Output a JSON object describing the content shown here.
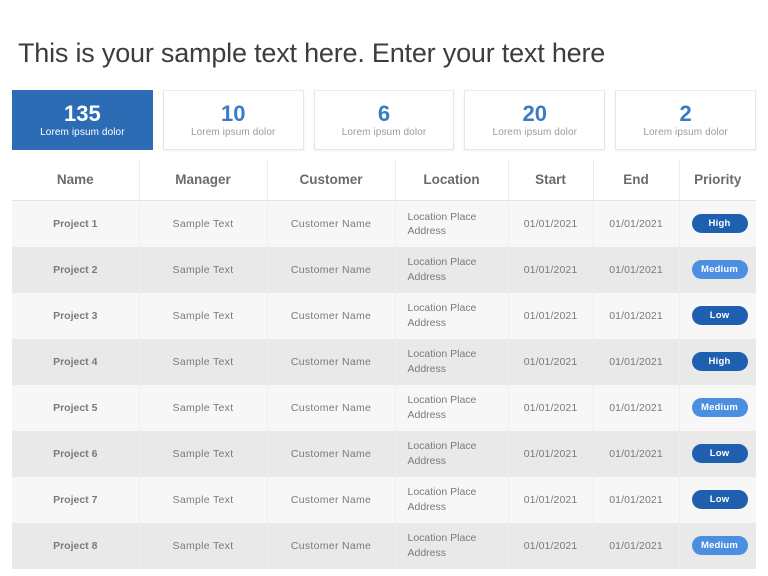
{
  "page_title": "This is your sample text here. Enter your text here",
  "colors": {
    "accent_dark": "#2b6cb5",
    "accent_number": "#3a7bc8",
    "badge_high": "#1f5fb0",
    "badge_low": "#1f5fb0",
    "badge_medium": "#4a8fe0",
    "row_odd": "#f7f7f7",
    "row_even": "#e9e9e9",
    "title_text": "#3d3d3d"
  },
  "kpis": [
    {
      "value": "135",
      "label": "Lorem ipsum dolor",
      "highlighted": true
    },
    {
      "value": "10",
      "label": "Lorem ipsum dolor",
      "highlighted": false
    },
    {
      "value": "6",
      "label": "Lorem ipsum dolor",
      "highlighted": false
    },
    {
      "value": "20",
      "label": "Lorem ipsum dolor",
      "highlighted": false
    },
    {
      "value": "2",
      "label": "Lorem ipsum dolor",
      "highlighted": false
    }
  ],
  "table": {
    "headers": [
      "Name",
      "Manager",
      "Customer",
      "Location",
      "Start",
      "End",
      "Priority"
    ],
    "rows": [
      {
        "name": "Project 1",
        "manager": "Sample Text",
        "customer": "Customer Name",
        "location": "Location Place Address",
        "start": "01/01/2021",
        "end": "01/01/2021",
        "priority": "High"
      },
      {
        "name": "Project 2",
        "manager": "Sample Text",
        "customer": "Customer Name",
        "location": "Location Place Address",
        "start": "01/01/2021",
        "end": "01/01/2021",
        "priority": "Medium"
      },
      {
        "name": "Project 3",
        "manager": "Sample Text",
        "customer": "Customer Name",
        "location": "Location Place Address",
        "start": "01/01/2021",
        "end": "01/01/2021",
        "priority": "Low"
      },
      {
        "name": "Project 4",
        "manager": "Sample Text",
        "customer": "Customer Name",
        "location": "Location Place Address",
        "start": "01/01/2021",
        "end": "01/01/2021",
        "priority": "High"
      },
      {
        "name": "Project 5",
        "manager": "Sample Text",
        "customer": "Customer Name",
        "location": "Location Place Address",
        "start": "01/01/2021",
        "end": "01/01/2021",
        "priority": "Medium"
      },
      {
        "name": "Project 6",
        "manager": "Sample Text",
        "customer": "Customer Name",
        "location": "Location Place Address",
        "start": "01/01/2021",
        "end": "01/01/2021",
        "priority": "Low"
      },
      {
        "name": "Project 7",
        "manager": "Sample Text",
        "customer": "Customer Name",
        "location": "Location Place Address",
        "start": "01/01/2021",
        "end": "01/01/2021",
        "priority": "Low"
      },
      {
        "name": "Project 8",
        "manager": "Sample Text",
        "customer": "Customer Name",
        "location": "Location Place Address",
        "start": "01/01/2021",
        "end": "01/01/2021",
        "priority": "Medium"
      }
    ]
  }
}
